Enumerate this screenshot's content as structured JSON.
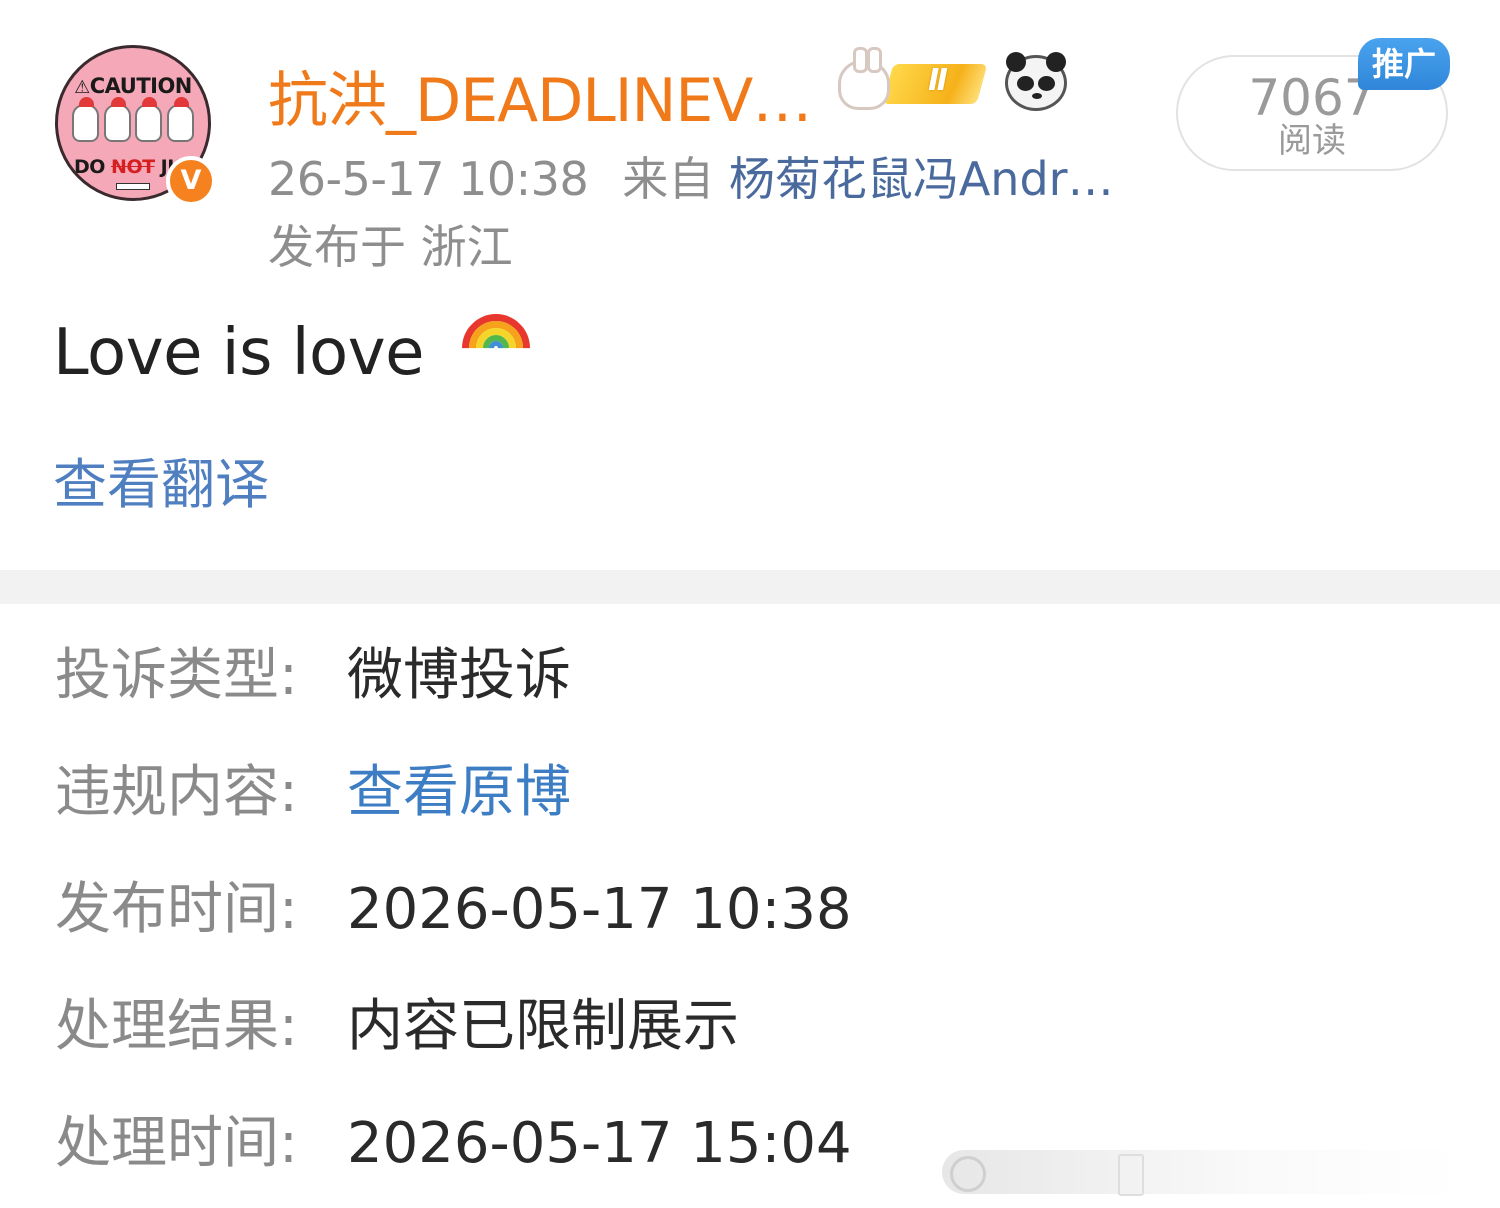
{
  "post": {
    "author": "抗洪_DEADLINEV…",
    "avatar": {
      "caution_text": "CAUTION",
      "bottom_prefix": "DO ",
      "bottom_struck": "NOT",
      "bottom_suffix": " JU"
    },
    "verified_badge": "V",
    "level_badge": "Ⅱ",
    "time": "26-5-17 10:38",
    "source_prefix": "来自",
    "source": "杨菊花鼠冯Andr…",
    "location": "发布于 浙江",
    "read_count": "7067",
    "read_label": "阅读",
    "promo_tag": "推广",
    "content": "Love is love",
    "emoji": "rainbow-emoji",
    "translate_link": "查看翻译"
  },
  "report": {
    "rows": [
      {
        "label": "投诉类型:",
        "value": "微博投诉"
      },
      {
        "label": "违规内容:",
        "value": "查看原博"
      },
      {
        "label": "发布时间:",
        "value": "2026-05-17 10:38"
      },
      {
        "label": "处理结果:",
        "value": "内容已限制展示"
      },
      {
        "label": "处理时间:",
        "value": "2026-05-17 15:04"
      }
    ]
  },
  "colors": {
    "username": "#f07a1a",
    "link": "#3d7dc4",
    "label": "#8a8a8a",
    "promo": "#2f86d9",
    "verified": "#f5821f"
  }
}
